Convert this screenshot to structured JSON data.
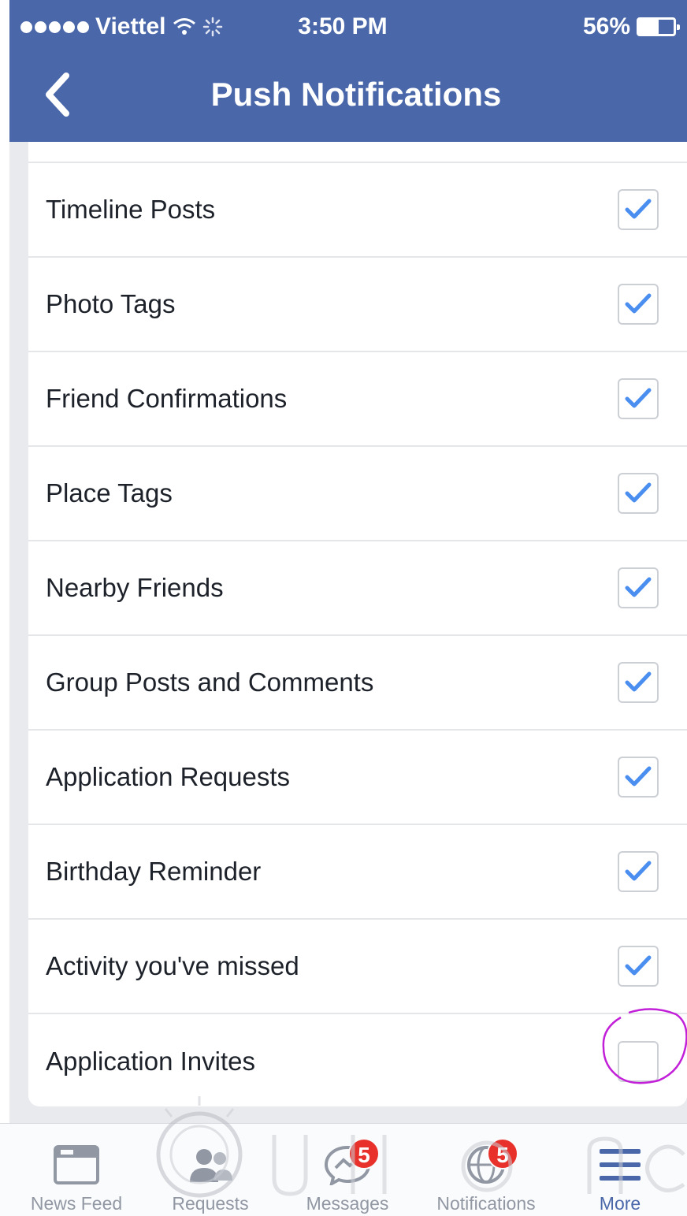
{
  "status_bar": {
    "carrier": "Viettel",
    "time": "3:50 PM",
    "battery_percent": "56%",
    "battery_level": 0.56
  },
  "nav": {
    "title": "Push Notifications",
    "back_icon": "chevron-left-icon"
  },
  "settings": {
    "items": [
      {
        "label": "Timeline Posts",
        "checked": true
      },
      {
        "label": "Photo Tags",
        "checked": true
      },
      {
        "label": "Friend Confirmations",
        "checked": true
      },
      {
        "label": "Place Tags",
        "checked": true
      },
      {
        "label": "Nearby Friends",
        "checked": true
      },
      {
        "label": "Group Posts and Comments",
        "checked": true
      },
      {
        "label": "Application Requests",
        "checked": true
      },
      {
        "label": "Birthday Reminder",
        "checked": true
      },
      {
        "label": "Activity you've missed",
        "checked": true
      },
      {
        "label": "Application Invites",
        "checked": false
      }
    ]
  },
  "tab_bar": {
    "tabs": [
      {
        "label": "News Feed",
        "icon": "news-feed-icon",
        "badge": ""
      },
      {
        "label": "Requests",
        "icon": "friend-requests-icon",
        "badge": ""
      },
      {
        "label": "Messages",
        "icon": "messages-icon",
        "badge": "5"
      },
      {
        "label": "Notifications",
        "icon": "globe-icon",
        "badge": "5"
      },
      {
        "label": "More",
        "icon": "menu-icon",
        "badge": ""
      }
    ],
    "active_tab": "More"
  },
  "colors": {
    "header_blue": "#4a67aa",
    "check_blue": "#4a8ef0",
    "badge_red": "#e8312b",
    "highlight_magenta": "#c21fd8"
  }
}
